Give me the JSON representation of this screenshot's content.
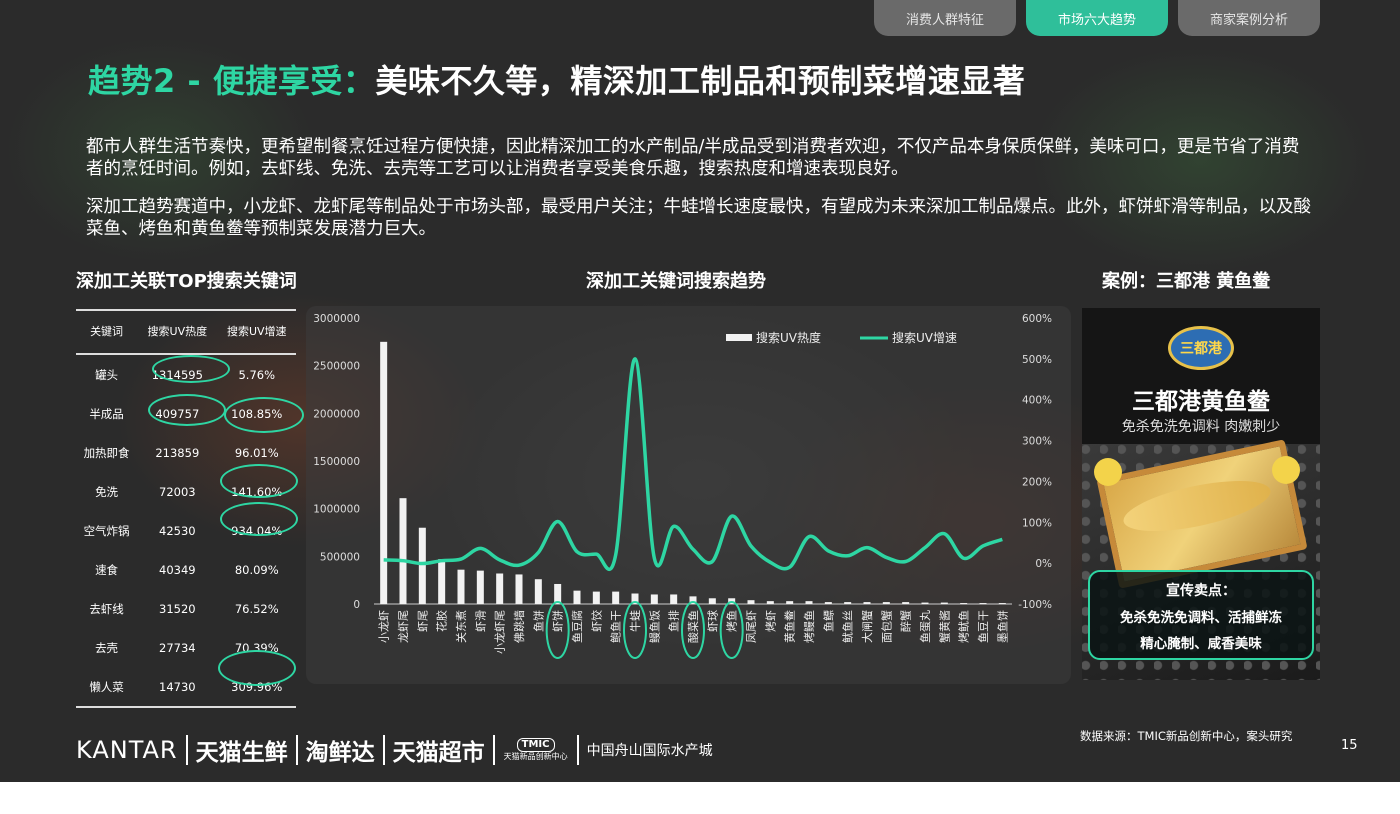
{
  "tabs": [
    {
      "label": "消费人群特征",
      "active": false
    },
    {
      "label": "市场六大趋势",
      "active": true
    },
    {
      "label": "商家案例分析",
      "active": false
    }
  ],
  "title": {
    "accent": "趋势2 - 便捷享受：",
    "main": "美味不久等，精深加工制品和预制菜增速显著"
  },
  "paragraphs": [
    "都市人群生活节奏快，更希望制餐烹饪过程方便快捷，因此精深加工的水产制品/半成品受到消费者欢迎，不仅产品本身保质保鲜，美味可口，更是节省了消费者的烹饪时间。例如，去虾线、免洗、去壳等工艺可以让消费者享受美食乐趣，搜索热度和增速表现良好。",
    "深加工趋势赛道中，小龙虾、龙虾尾等制品处于市场头部，最受用户关注；牛蛙增长速度最快，有望成为未来深加工制品爆点。此外，虾饼虾滑等制品，以及酸菜鱼、烤鱼和黄鱼鲞等预制菜发展潜力巨大。"
  ],
  "left_section": {
    "title": "深加工关联TOP搜索关键词",
    "headers": [
      "关键词",
      "搜索UV热度",
      "搜索UV增速"
    ],
    "rows": [
      {
        "kw": "罐头",
        "uv": "1314595",
        "growth": "5.76%"
      },
      {
        "kw": "半成品",
        "uv": "409757",
        "growth": "108.85%"
      },
      {
        "kw": "加热即食",
        "uv": "213859",
        "growth": "96.01%"
      },
      {
        "kw": "免洗",
        "uv": "72003",
        "growth": "141.60%"
      },
      {
        "kw": "空气炸锅",
        "uv": "42530",
        "growth": "934.04%"
      },
      {
        "kw": "速食",
        "uv": "40349",
        "growth": "80.09%"
      },
      {
        "kw": "去虾线",
        "uv": "31520",
        "growth": "76.52%"
      },
      {
        "kw": "去壳",
        "uv": "27734",
        "growth": "70.39%"
      },
      {
        "kw": "懒人菜",
        "uv": "14730",
        "growth": "309.96%"
      }
    ]
  },
  "chart_section": {
    "title": "深加工关键词搜索趋势"
  },
  "chart_data": {
    "type": "bar",
    "categories": [
      "小龙虾",
      "龙虾尾",
      "虾尾",
      "花胶",
      "关东煮",
      "虾滑",
      "小龙虾尾",
      "佛跳墙",
      "鱼饼",
      "虾饼",
      "鱼豆腐",
      "虾饺",
      "鲍鱼干",
      "牛蛙",
      "鳗鱼饭",
      "鱼排",
      "酸菜鱼",
      "虾球",
      "烤鱼",
      "凤尾虾",
      "烤虾",
      "黄鱼鲞",
      "烤鳗鱼",
      "鱼鳔",
      "鱿鱼丝",
      "大闸蟹",
      "面包蟹",
      "醉蟹",
      "鱼蛋丸",
      "蟹黄酱",
      "烤鱿鱼",
      "鱼豆干",
      "墨鱼饼"
    ],
    "series": [
      {
        "name": "搜索UV热度",
        "type": "bar",
        "values": [
          2750000,
          1110000,
          800000,
          470000,
          360000,
          350000,
          320000,
          310000,
          260000,
          210000,
          140000,
          130000,
          130000,
          110000,
          100000,
          100000,
          80000,
          60000,
          60000,
          40000,
          30000,
          30000,
          30000,
          20000,
          20000,
          20000,
          20000,
          20000,
          15000,
          15000,
          10000,
          10000,
          10000
        ]
      },
      {
        "name": "搜索UV增速",
        "type": "line",
        "values": [
          0.08,
          0.06,
          -0.01,
          0.06,
          0.1,
          0.36,
          0.08,
          -0.05,
          0.26,
          1.02,
          0.28,
          0.22,
          0.2,
          5.0,
          0.12,
          0.9,
          0.34,
          0.04,
          1.15,
          0.42,
          0.02,
          -0.1,
          0.65,
          0.3,
          0.18,
          0.38,
          0.14,
          0.04,
          0.38,
          0.72,
          0.12,
          0.42,
          0.58
        ]
      }
    ],
    "y_ticks": [
      "0",
      "500000",
      "1000000",
      "1500000",
      "2000000",
      "2500000",
      "3000000"
    ],
    "y2_ticks": [
      "-100%",
      "0%",
      "100%",
      "200%",
      "300%",
      "400%",
      "500%",
      "600%"
    ],
    "ylim": [
      0,
      3000000
    ],
    "y2lim": [
      -1,
      6
    ],
    "legend": [
      "搜索UV热度",
      "搜索UV增速"
    ],
    "legend_position": "top-right",
    "highlighted": [
      "虾饼",
      "牛蛙",
      "酸菜鱼",
      "烤鱼"
    ],
    "colors": {
      "bar": "#f2f2f2",
      "line": "#2ed6a3",
      "axis": "#cccccc"
    }
  },
  "case": {
    "title": "案例：三都港 黄鱼鲞",
    "logo_text": "三都港",
    "product_name": "三都港黄鱼鲞",
    "product_desc": "免杀免洗免调料 肉嫩刺少",
    "selling_title": "宣传卖点：",
    "selling_lines": [
      "免杀免洗免调料、活捕鲜冻",
      "精心腌制、咸香美味"
    ]
  },
  "footer": {
    "brands": [
      "KANTAR",
      "天猫生鲜",
      "淘鲜达",
      "天猫超市"
    ],
    "tmic_badge": "TMIC",
    "tmic_sub": "天猫新品创新中心",
    "partner": "中国舟山国际水产城",
    "source": "数据来源：TMIC新品创新中心，案头研究",
    "page": "15"
  },
  "colors": {
    "accent": "#2ed6a3",
    "tab_active": "#2fbf9a",
    "tab": "#6a6a6a",
    "background": "#2b2b2b"
  }
}
